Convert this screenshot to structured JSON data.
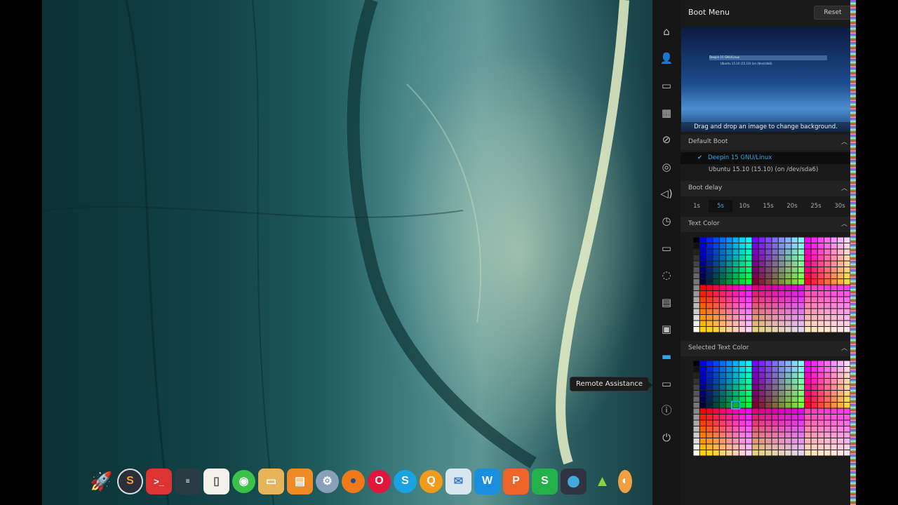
{
  "tooltip": {
    "remote": "Remote Assistance"
  },
  "panel": {
    "title": "Boot Menu",
    "reset": "Reset",
    "preview_hint": "Drag and drop an image to change background.",
    "preview_line1": "Deepin 15 GNU/Linux",
    "preview_line2": "Ubuntu 15.10 (15.10) (on /dev/sda6)",
    "default_boot": {
      "label": "Default Boot",
      "items": [
        "Deepin 15 GNU/Linux",
        "Ubuntu 15.10 (15.10) (on /dev/sda6)"
      ],
      "selected": "Deepin 15 GNU/Linux"
    },
    "boot_delay": {
      "label": "Boot delay",
      "options": [
        "1s",
        "5s",
        "10s",
        "15s",
        "20s",
        "25s",
        "30s"
      ],
      "selected": "5s"
    },
    "text_color": {
      "label": "Text Color"
    },
    "selected_text_color": {
      "label": "Selected Text Color"
    }
  },
  "sidebar_icons": [
    "home-icon",
    "account-icon",
    "display-icon",
    "calendar-icon",
    "personalization-icon",
    "network-icon",
    "sound-icon",
    "time-icon",
    "power-icon",
    "mouse-icon",
    "keyboard-icon",
    "update-icon",
    "boot-menu-icon",
    "remote-assistance-icon",
    "info-icon",
    "shutdown-icon"
  ],
  "dock": [
    "launcher",
    "deepin-store",
    "terminal",
    "code-editor",
    "text-editor",
    "wechat",
    "file-manager",
    "app-store",
    "settings",
    "firefox",
    "opera",
    "skype",
    "qq",
    "mail",
    "wps-writer",
    "wps-presentation",
    "wps-spreadsheet",
    "toggle",
    "android",
    "more"
  ],
  "colors": {
    "accent": "#2ea7e8"
  }
}
